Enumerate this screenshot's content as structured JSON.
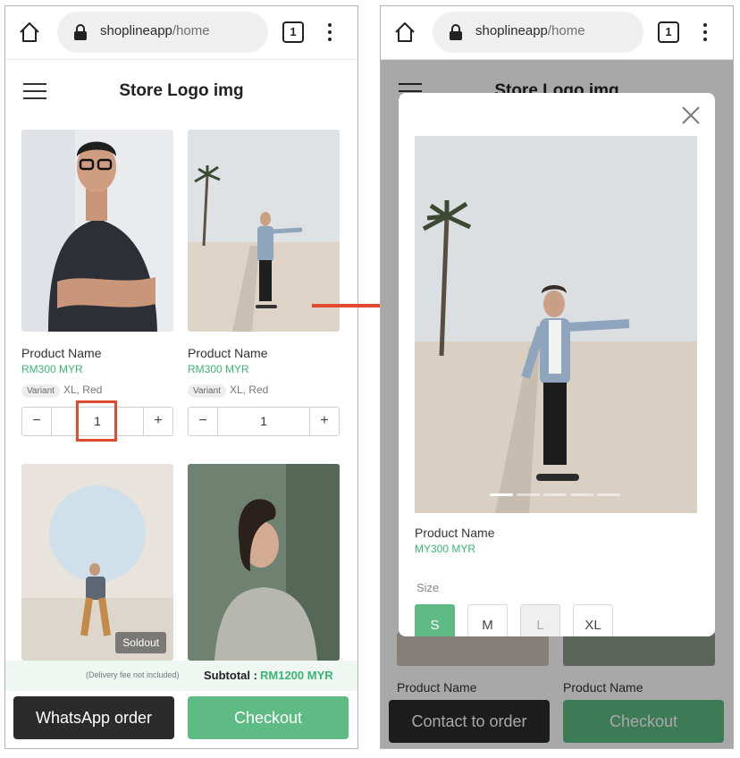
{
  "browser": {
    "domain": "shoplineapp",
    "path": "/home",
    "tab_count": "1"
  },
  "store": {
    "logo_text": "Store Logo img"
  },
  "products": [
    {
      "name": "Product Name",
      "price": "RM300 MYR",
      "variant_tag": "Variant",
      "variant_value": "XL, Red",
      "qty": "1"
    },
    {
      "name": "Product Name",
      "price": "RM300 MYR",
      "variant_tag": "Variant",
      "variant_value": "XL, Red",
      "qty": "1"
    },
    {
      "soldout_label": "Soldout"
    },
    {}
  ],
  "qty_controls": {
    "minus": "−",
    "plus": "+"
  },
  "footer": {
    "delivery_note": "(Delivery fee not included)",
    "subtotal_label": "Subtotal :",
    "subtotal_value": "RM1200 MYR",
    "whatsapp_label": "WhatsApp order",
    "checkout_label": "Checkout",
    "contact_label": "Contact to order"
  },
  "modal": {
    "product_name": "Product Name",
    "product_price": "MY300 MYR",
    "size_label": "Size",
    "sizes": [
      "S",
      "M",
      "L",
      "XL"
    ],
    "selected_size": "S",
    "disabled_sizes": [
      "L"
    ],
    "carousel_total": 5,
    "carousel_active": 1
  },
  "behind_modal": {
    "left_product_name": "Product Name",
    "right_product_name": "Product Name"
  },
  "colors": {
    "accent_green": "#3ab574",
    "button_green": "#5dbb83",
    "dark_button": "#2b2b2b",
    "highlight_red": "#e04a2f"
  }
}
